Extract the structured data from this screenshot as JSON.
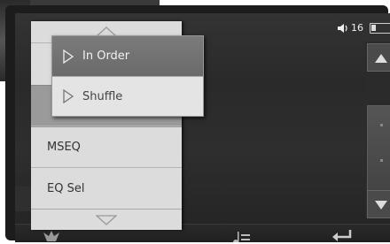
{
  "status": {
    "volume_value": "16"
  },
  "menu": {
    "items": [
      {
        "label": ""
      },
      {
        "label": ""
      },
      {
        "label": "MSEQ"
      },
      {
        "label": "EQ Sel"
      }
    ]
  },
  "submenu": {
    "items": [
      {
        "label": "In Order",
        "selected": true
      },
      {
        "label": "Shuffle",
        "selected": false
      }
    ]
  },
  "icons": {
    "volume": "speaker-icon",
    "battery": "battery-icon",
    "scroll_up": "triangle-up-icon",
    "scroll_down": "triangle-down-icon",
    "menu_up": "chevron-up-icon",
    "menu_down": "chevron-down-icon",
    "submenu_item": "play-triangle-icon",
    "playlist": "playlist-icon",
    "back": "return-icon"
  }
}
